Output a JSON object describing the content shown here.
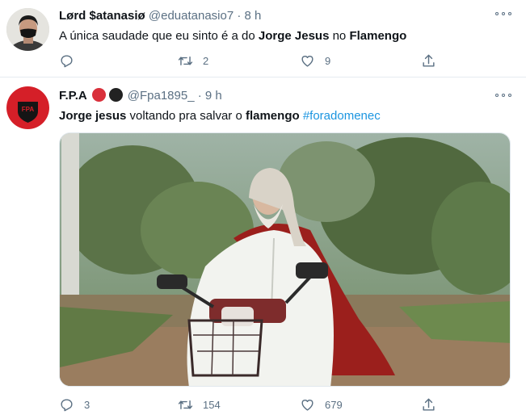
{
  "tweets": [
    {
      "author_name": "Lørd $atanasiø",
      "handle": "@eduatanasio7",
      "separator": "·",
      "time": "8 h",
      "text_plain_1": "A única saudade que eu sinto é a do ",
      "text_bold_1": "Jorge Jesus",
      "text_plain_2": " no ",
      "text_bold_2": "Flamengo",
      "reply_count": "",
      "retweet_count": "2",
      "like_count": "9"
    },
    {
      "author_name": "F.P.A",
      "handle": "@Fpa1895_",
      "separator": "·",
      "time": "9 h",
      "text_bold_1": "Jorge jesus",
      "text_plain_1": " voltando pra salvar o ",
      "text_bold_2": "flamengo",
      "text_plain_2": " ",
      "hashtag": "#foradomenec",
      "avatar_label": "FPA",
      "reply_count": "3",
      "retweet_count": "154",
      "like_count": "679"
    }
  ],
  "colors": {
    "text": "#0f1419",
    "secondary": "#5b7083",
    "link": "#1b95e0",
    "divider": "#e6ecf0"
  },
  "icons": [
    "reply-icon",
    "retweet-icon",
    "like-icon",
    "share-icon",
    "more-icon"
  ]
}
